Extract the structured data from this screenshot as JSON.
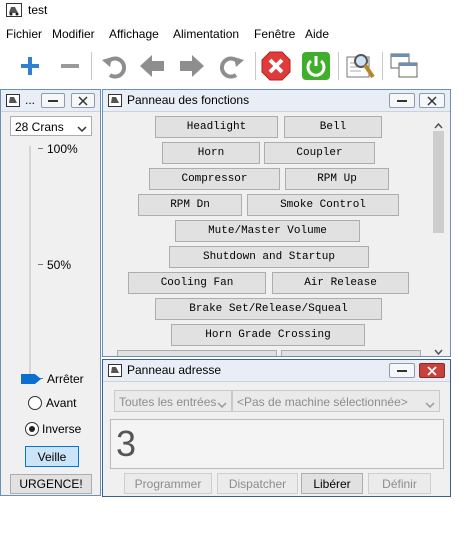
{
  "app": {
    "title": "test"
  },
  "menu": [
    "Fichier",
    "Modifier",
    "Affichage",
    "Alimentation",
    "Fenêtre",
    "Aide"
  ],
  "toolbar": {
    "icons": [
      "plus-icon",
      "minus-icon",
      "undo-icon",
      "arrow-left-icon",
      "arrow-right-icon",
      "redo-icon",
      "stop-icon",
      "power-icon",
      "edit-icon",
      "windows-icon"
    ],
    "colors": {
      "blue": "#2f7fd6",
      "gray": "#8e8e8e",
      "red": "#e03a3a",
      "green": "#3fae2a"
    }
  },
  "throttle": {
    "title": "...",
    "speed_steps": "28 Crans",
    "label_100": "100%",
    "label_50": "50%",
    "speed_value": 0,
    "stop_label": "Arrêter",
    "forward_label": "Avant",
    "reverse_label": "Inverse",
    "direction": "Inverse",
    "idle_label": "Veille",
    "emergency_label": "URGENCE!"
  },
  "functions": {
    "title": "Panneau des fonctions",
    "rows": [
      [
        "Headlight",
        "Bell"
      ],
      [
        "Horn",
        "Coupler"
      ],
      [
        "Compressor",
        "RPM Up"
      ],
      [
        "RPM Dn",
        "Smoke Control"
      ],
      [
        "Mute/Master Volume"
      ],
      [
        "Shutdown and Startup"
      ],
      [
        "Cooling Fan",
        "Air Release"
      ],
      [
        "Brake Set/Release/Squeal"
      ],
      [
        "Horn Grade Crossing"
      ]
    ]
  },
  "address": {
    "title": "Panneau adresse",
    "filter": "Toutes les entrées",
    "machine_placeholder": "<Pas de machine sélectionnée>",
    "address_value": "3",
    "buttons": {
      "program": "Programmer",
      "dispatch": "Dispatcher",
      "release": "Libérer",
      "define": "Définir"
    }
  }
}
